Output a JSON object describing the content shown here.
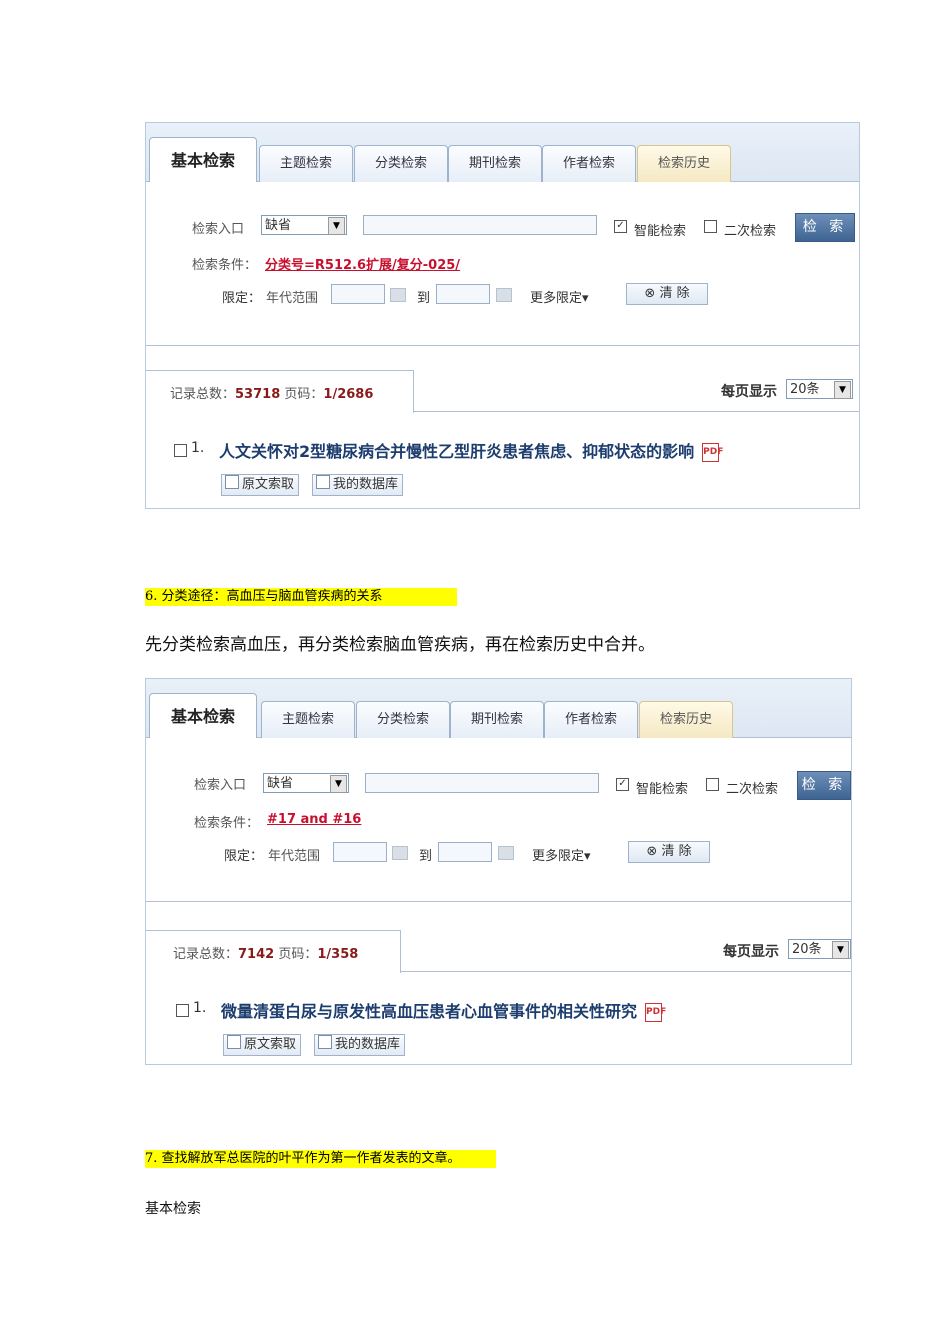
{
  "panels": [
    {
      "tabs": {
        "basic": "基本检索",
        "subject": "主题检索",
        "classify": "分类检索",
        "journal": "期刊检索",
        "author": "作者检索",
        "history": "检索历史"
      },
      "search": {
        "entry_label": "检索入口",
        "entry_value": "缺省",
        "smart_label": "智能检索",
        "secondary_label": "二次检索",
        "search_button": "检 索",
        "condition_label": "检索条件：",
        "condition_value": "分类号=R512.6扩展/复分-025/",
        "limit_label": "限定：",
        "year_range_label": "年代范围",
        "to_label": "到",
        "more_limits": "更多限定▾",
        "clear_button": "清 除"
      },
      "results": {
        "total_label": "记录总数：",
        "total_value": "53718",
        "page_label": "页码：",
        "page_value": "1/2686",
        "per_page_label": "每页显示",
        "per_page_value": "20条",
        "item_number": "1.",
        "item_title": "人文关怀对2型糖尿病合并慢性乙型肝炎患者焦虑、抑郁状态的影响",
        "btn_fulltext": "原文索取",
        "btn_mydb": "我的数据库"
      }
    },
    {
      "tabs": {
        "basic": "基本检索",
        "subject": "主题检索",
        "classify": "分类检索",
        "journal": "期刊检索",
        "author": "作者检索",
        "history": "检索历史"
      },
      "search": {
        "entry_label": "检索入口",
        "entry_value": "缺省",
        "smart_label": "智能检索",
        "secondary_label": "二次检索",
        "search_button": "检 索",
        "condition_label": "检索条件：",
        "condition_value": "#17 and #16",
        "limit_label": "限定：",
        "year_range_label": "年代范围",
        "to_label": "到",
        "more_limits": "更多限定▾",
        "clear_button": "清 除"
      },
      "results": {
        "total_label": "记录总数：",
        "total_value": "7142",
        "page_label": "页码：",
        "page_value": "1/358",
        "per_page_label": "每页显示",
        "per_page_value": "20条",
        "item_number": "1.",
        "item_title": "微量清蛋白尿与原发性高血压患者心血管事件的相关性研究",
        "btn_fulltext": "原文索取",
        "btn_mydb": "我的数据库"
      }
    }
  ],
  "doc": {
    "heading6": "6.   分类途径：高血压与脑血管疾病的关系",
    "para6": "先分类检索高血压，再分类检索脑血管疾病，再在检索历史中合并。",
    "heading7": "7.  查找解放军总医院的叶平作为第一作者发表的文章。",
    "para7": "基本检索"
  }
}
